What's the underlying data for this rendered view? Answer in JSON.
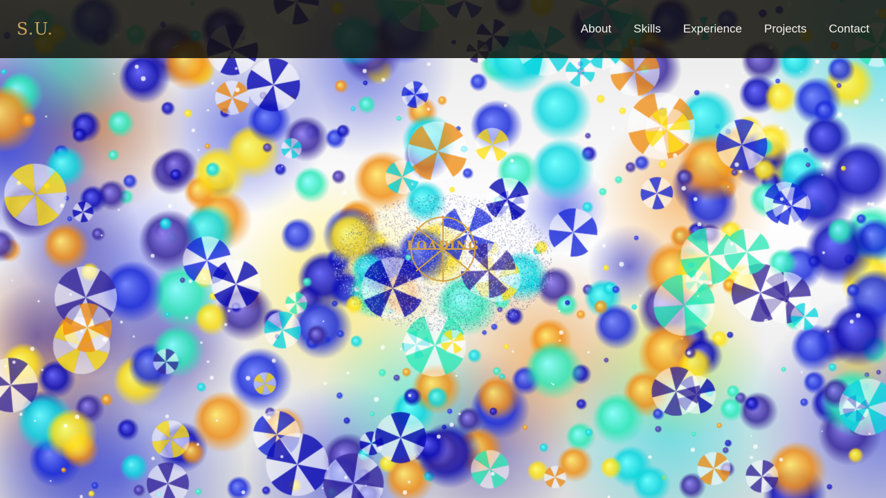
{
  "header": {
    "logo": "S.U.",
    "nav": [
      {
        "label": "About"
      },
      {
        "label": "Skills"
      },
      {
        "label": "Experience"
      },
      {
        "label": "Projects"
      },
      {
        "label": "Contact"
      }
    ]
  },
  "loader": {
    "text": "LOADING"
  },
  "colors": {
    "navbar_bg": "#14120a",
    "logo": "#c8a45c",
    "nav_text": "#f4f1ea",
    "loader_gold": "#d2a445",
    "bokeh_palette": [
      "#1a2bd8",
      "#10d6e0",
      "#ffe21a",
      "#f0901a",
      "#2fe8b8",
      "#3a2a9a",
      "#0a0ab0"
    ]
  },
  "icons": {
    "loader": "loading-compass-icon"
  }
}
